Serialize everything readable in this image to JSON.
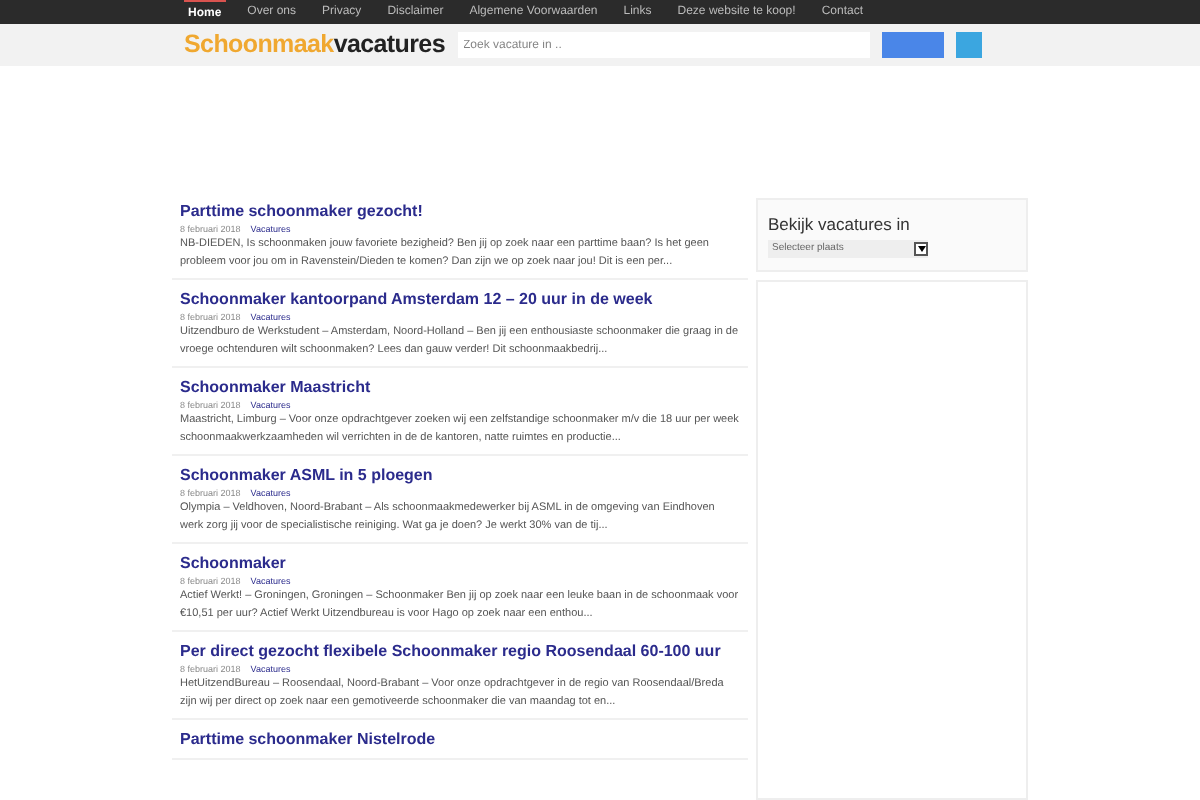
{
  "nav": [
    {
      "label": "Home",
      "selected": true
    },
    {
      "label": "Over ons",
      "selected": false
    },
    {
      "label": "Privacy",
      "selected": false
    },
    {
      "label": "Disclaimer",
      "selected": false
    },
    {
      "label": "Algemene Voorwaarden",
      "selected": false
    },
    {
      "label": "Links",
      "selected": false
    },
    {
      "label": "Deze website te koop!",
      "selected": false
    },
    {
      "label": "Contact",
      "selected": false
    }
  ],
  "logo": {
    "part1": "Schoonmaak",
    "part2": "vacatures"
  },
  "search": {
    "placeholder": "Zoek vacature in .."
  },
  "posts": [
    {
      "title": "Parttime schoonmaker gezocht!",
      "date": "8 februari 2018",
      "category": "Vacatures",
      "excerpt": "NB-DIEDEN, Is schoonmaken jouw favoriete bezigheid? Ben jij op zoek naar een parttime baan? Is het geen probleem voor jou om in Ravenstein/Dieden te komen? Dan zijn we op zoek naar jou! Dit is een per..."
    },
    {
      "title": "Schoonmaker kantoorpand Amsterdam 12 – 20 uur in de week",
      "date": "8 februari 2018",
      "category": "Vacatures",
      "excerpt": "Uitzendburo de Werkstudent – Amsterdam, Noord-Holland – Ben jij een enthousiaste schoonmaker die graag in de vroege ochtenduren wilt schoonmaken? Lees dan gauw verder! Dit schoonmaakbedrij..."
    },
    {
      "title": "Schoonmaker Maastricht",
      "date": "8 februari 2018",
      "category": "Vacatures",
      "excerpt": "Maastricht, Limburg – Voor onze opdrachtgever zoeken wij een zelfstandige schoonmaker m/v die 18 uur per week schoonmaakwerkzaamheden wil verrichten in de de kantoren, natte ruimtes en productie..."
    },
    {
      "title": "Schoonmaker ASML in 5 ploegen",
      "date": "8 februari 2018",
      "category": "Vacatures",
      "excerpt": "Olympia – Veldhoven, Noord-Brabant – Als schoonmaakmedewerker bij ASML in de omgeving van Eindhoven werk zorg jij voor de specialistische reiniging. Wat ga je doen? Je werkt 30% van de tij..."
    },
    {
      "title": "Schoonmaker",
      "date": "8 februari 2018",
      "category": "Vacatures",
      "excerpt": "Actief Werkt! – Groningen, Groningen – Schoonmaker Ben jij op zoek naar een leuke baan in de schoonmaak voor €10,51 per uur? Actief Werkt Uitzendbureau is voor Hago op zoek naar een enthou..."
    },
    {
      "title": "Per direct gezocht flexibele Schoonmaker regio Roosendaal 60-100 uur",
      "date": "8 februari 2018",
      "category": "Vacatures",
      "excerpt": "HetUitzendBureau – Roosendaal, Noord-Brabant – Voor onze opdrachtgever in de regio van Roosendaal/Breda zijn wij per direct op zoek naar een gemotiveerde schoonmaker die van maandag tot en..."
    },
    {
      "title": "Parttime schoonmaker Nistelrode"
    }
  ],
  "sidebar": {
    "title": "Bekijk vacatures in",
    "select": "Selecteer plaats"
  }
}
